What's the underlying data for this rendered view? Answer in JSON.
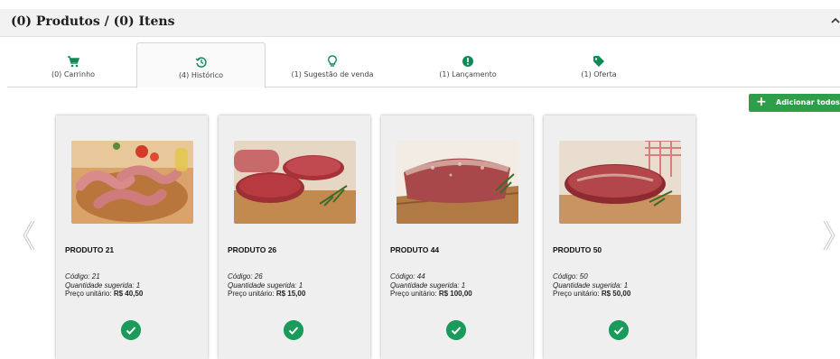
{
  "header": {
    "title": "(0) Produtos / (0) Itens"
  },
  "tabs": [
    {
      "label": "(0) Carrinho",
      "icon": "cart-icon"
    },
    {
      "label": "(4) Histórico",
      "icon": "history-icon"
    },
    {
      "label": "(1) Sugestão de venda",
      "icon": "lightbulb-icon"
    },
    {
      "label": "(1) Lançamento",
      "icon": "alert-icon"
    },
    {
      "label": "(1) Oferta",
      "icon": "tag-icon"
    }
  ],
  "active_tab": "(4) Histórico",
  "toolbar": {
    "add_all_label": "Adicionar todos"
  },
  "products": [
    {
      "name": "PRODUTO 21",
      "code": "Código: 21",
      "qty": "Quantidade sugerida: 1",
      "price_label": "Preço unitário:",
      "price": "R$ 40,50"
    },
    {
      "name": "PRODUTO 26",
      "code": "Código: 26",
      "qty": "Quantidade sugerida: 1",
      "price_label": "Preço unitário:",
      "price": "R$ 15,00"
    },
    {
      "name": "PRODUTO 44",
      "code": "Código: 44",
      "qty": "Quantidade sugerida: 1",
      "price_label": "Preço unitário:",
      "price": "R$ 100,00"
    },
    {
      "name": "PRODUTO 50",
      "code": "Código: 50",
      "qty": "Quantidade sugerida: 1",
      "price_label": "Preço unitário:",
      "price": "R$ 50,00"
    }
  ],
  "colors": {
    "accent": "#1a9a5b",
    "button": "#2e9e4a"
  }
}
